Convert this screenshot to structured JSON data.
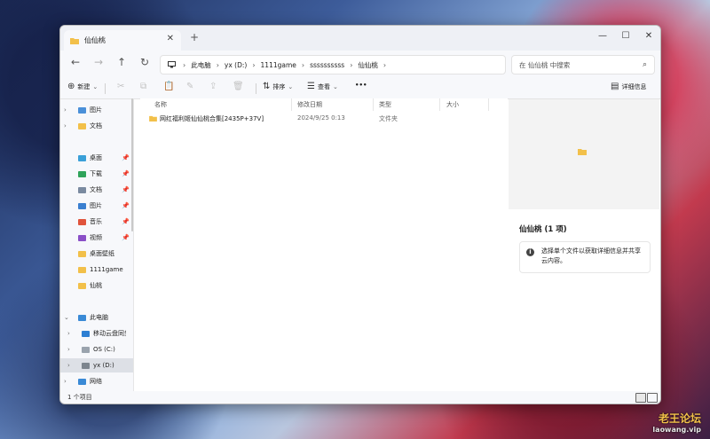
{
  "wallpaper": {
    "watermark_line1": "老王论坛",
    "watermark_line2": "laowang.vip"
  },
  "window": {
    "tab_title": "仙仙桃",
    "tab_close": "✕",
    "new_tab": "+",
    "controls": {
      "minimize": "—",
      "maximize": "☐",
      "close": "✕"
    }
  },
  "nav": {
    "back": "←",
    "forward": "→",
    "up": "↑",
    "refresh": "↻",
    "breadcrumb": [
      "此电脑",
      "yx (D:)",
      "1111game",
      "ssssssssss",
      "仙仙桃"
    ],
    "search_placeholder": "在 仙仙桃 中搜索",
    "search_icon": "⌕"
  },
  "toolbar": {
    "new_label": "新建",
    "sort_label": "排序",
    "view_label": "查看",
    "more_label": "•••",
    "details_pane_label": "详细信息",
    "icons": {
      "new": "⊕",
      "cut": "✂",
      "copy": "⧉",
      "paste": "📋",
      "rename": "✎",
      "share": "⇪",
      "delete": "🗑",
      "sort": "⇅",
      "view": "☰",
      "details": "▤"
    }
  },
  "sidebar": {
    "items": [
      {
        "label": "图片",
        "icon": "pictures-icon",
        "color": "#4a90d9",
        "chevron": "›",
        "pin": ""
      },
      {
        "label": "文档",
        "icon": "folder-icon",
        "color": "#f2c04a",
        "chevron": "›",
        "pin": ""
      },
      {
        "label": "桌面",
        "icon": "desktop-icon",
        "color": "#3aa0d8",
        "chevron": "",
        "pin": "📌"
      },
      {
        "label": "下载",
        "icon": "download-icon",
        "color": "#2fa35a",
        "chevron": "",
        "pin": "📌"
      },
      {
        "label": "文档",
        "icon": "documents-icon",
        "color": "#7a8aa0",
        "chevron": "",
        "pin": "📌"
      },
      {
        "label": "图片",
        "icon": "pictures-icon",
        "color": "#3a7fd0",
        "chevron": "",
        "pin": "📌"
      },
      {
        "label": "音乐",
        "icon": "music-icon",
        "color": "#e0543c",
        "chevron": "",
        "pin": "📌"
      },
      {
        "label": "视频",
        "icon": "video-icon",
        "color": "#8a4fc7",
        "chevron": "",
        "pin": "📌"
      },
      {
        "label": "桌面壁纸",
        "icon": "folder-icon",
        "color": "#f2c04a",
        "chevron": "",
        "pin": ""
      },
      {
        "label": "1111game",
        "icon": "folder-icon",
        "color": "#f2c04a",
        "chevron": "",
        "pin": ""
      },
      {
        "label": "仙桃",
        "icon": "folder-icon",
        "color": "#f2c04a",
        "chevron": "",
        "pin": ""
      },
      {
        "label": "此电脑",
        "icon": "this-pc-icon",
        "color": "#3a8ad6",
        "chevron": "⌄",
        "pin": ""
      },
      {
        "label": "移动云盘同步盘",
        "icon": "cloud-drive-icon",
        "color": "#2d7fd3",
        "chevron": "›",
        "pin": ""
      },
      {
        "label": "OS (C:)",
        "icon": "drive-icon",
        "color": "#9aa3ad",
        "chevron": "›",
        "pin": ""
      },
      {
        "label": "yx (D:)",
        "icon": "drive-icon",
        "color": "#7d858e",
        "chevron": "›",
        "pin": ""
      },
      {
        "label": "网络",
        "icon": "network-icon",
        "color": "#3a8ad6",
        "chevron": "›",
        "pin": ""
      }
    ]
  },
  "files": {
    "columns": {
      "name": "名称",
      "modified": "修改日期",
      "type": "类型",
      "size": "大小"
    },
    "rows": [
      {
        "name": "网红福利姬仙仙桃合集[2435P+37V]",
        "modified": "2024/9/25 0:13",
        "type": "文件夹",
        "size": ""
      }
    ]
  },
  "details": {
    "title": "仙仙桃 (1 项)",
    "info_icon": "i",
    "info_text": "选择单个文件以获取详细信息并共享云内容。"
  },
  "status": {
    "count": "1 个项目"
  },
  "colors": {
    "folder": "#f2c04a",
    "selection": "#dde0e6",
    "accent": "#0067c0"
  }
}
